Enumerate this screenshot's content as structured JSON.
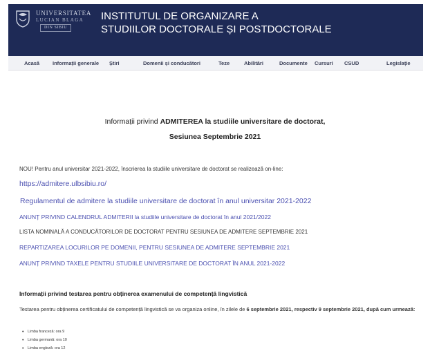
{
  "header": {
    "logo_line1": "UNIVERSITATEA",
    "logo_line2": "LUCIAN BLAGA",
    "logo_line3": "DIN SIBIU",
    "title_line1": "INSTITUTUL DE ORGANIZARE A",
    "title_line2": "STUDIILOR DOCTORALE ȘI POSTDOCTORALE",
    "bg_color": "#1e2a56"
  },
  "nav": {
    "items": [
      "Acasă",
      "Informații generale",
      "Știri",
      "Domenii și conducători",
      "Teze",
      "Abilitări",
      "Documente",
      "Cursuri",
      "CSUD",
      "Legislație"
    ]
  },
  "main": {
    "heading_prefix": "Informații privind ",
    "heading_bold": "ADMITEREA la studiile universitare de doctorat,",
    "subheading": "Sesiunea Septembrie 2021",
    "notice": "NOU! Pentru anul universitar 2021-2022, înscrierea la studiile universitare de doctorat se realizează on-line:",
    "admission_link": "https://admitere.ulbsibiu.ro/",
    "regulation_link": " Regulamentul de admitere la studiile universitare de doctorat în anul universitar 2021-2022",
    "calendar_link": "ANUNȚ PRIVIND CALENDRUL ADMITERII  la studiile universitare de doctorat în anul 2021/2022",
    "supervisors_list": "LISTA NOMINALĂ A CONDUCĂTORILOR DE DOCTORAT PENTRU SESIUNEA DE ADMITERE SEPTEMBRIE 2021",
    "allocation_link": "REPARTIZAREA LOCURILOR PE DOMENII, PENTRU SESIUNEA DE ADMITERE SEPTEMBRIE 2021",
    "fees_link": "ANUNȚ PRIVIND TAXELE PENTRU STUDIILE UNIVERSITARE DE DOCTORAT ÎN ANUL 2021-2022",
    "lang_heading": "Informații privind testarea pentru obținerea examenului de competență lingvistică",
    "lang_para_start": "Testarea pentru obținerea certificatului de competență lingvistică se va organiza online, în zilele de ",
    "lang_para_bold": "6 septembrie 2021, respectiv 9 septembrie 2021, după cum urmează:",
    "schedule": [
      "Limba franceză: ora 9",
      "Limba germană: ora 10",
      "Limba engleză: ora 12"
    ]
  }
}
